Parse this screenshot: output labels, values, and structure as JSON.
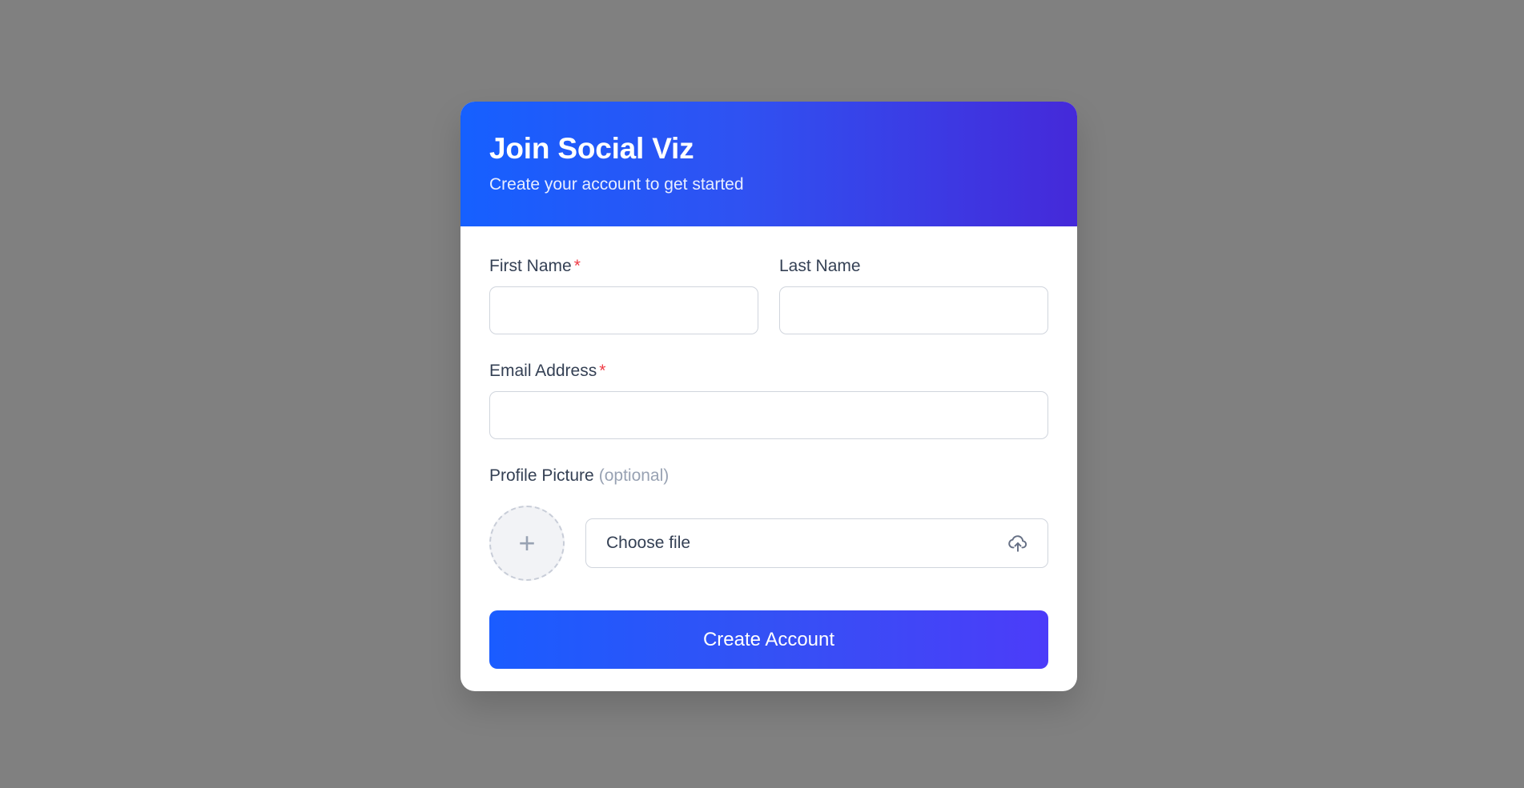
{
  "header": {
    "title": "Join Social Viz",
    "subtitle": "Create your account to get started"
  },
  "form": {
    "first_name": {
      "label": "First Name",
      "required_marker": "*",
      "value": "",
      "placeholder": ""
    },
    "last_name": {
      "label": "Last Name",
      "value": "",
      "placeholder": ""
    },
    "email": {
      "label": "Email Address",
      "required_marker": "*",
      "value": "",
      "placeholder": ""
    },
    "profile_picture": {
      "label": "Profile Picture",
      "optional_note": "(optional)",
      "avatar_icon": "plus-icon",
      "file_label": "Choose file",
      "file_icon": "cloud-upload-icon"
    },
    "submit_label": "Create Account"
  },
  "colors": {
    "header_gradient_start": "#1660ff",
    "header_gradient_end": "#4529d9",
    "button_gradient_start": "#1a5cff",
    "button_gradient_end": "#4c3cf9",
    "required": "#ef3b45",
    "background": "#808080"
  }
}
